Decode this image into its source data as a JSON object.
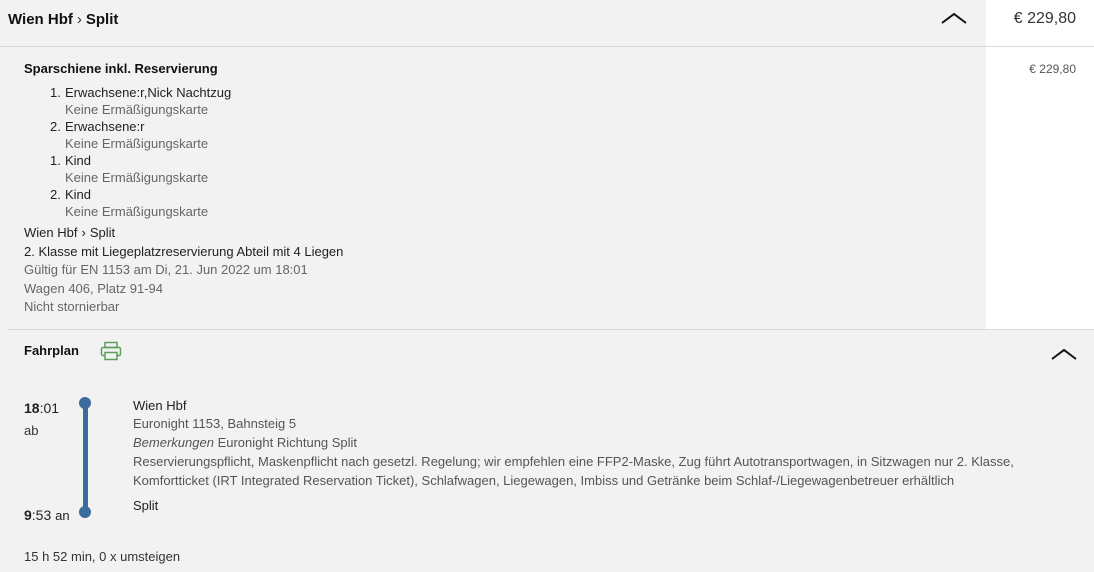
{
  "header": {
    "from": "Wien Hbf",
    "to": "Split",
    "total_price": "€ 229,80"
  },
  "ticket": {
    "title": "Sparschiene inkl. Reservierung",
    "price": "€ 229,80",
    "passengers": [
      {
        "num": "1.",
        "name": "Erwachsene:r,Nick Nachtzug",
        "card": "Keine Ermäßigungskarte"
      },
      {
        "num": "2.",
        "name": "Erwachsene:r",
        "card": "Keine Ermäßigungskarte"
      },
      {
        "num": "1.",
        "name": "Kind",
        "card": "Keine Ermäßigungskarte"
      },
      {
        "num": "2.",
        "name": "Kind",
        "card": "Keine Ermäßigungskarte"
      }
    ],
    "route_from": "Wien Hbf",
    "route_to": "Split",
    "class_info": "2. Klasse mit Liegeplatzreservierung Abteil mit 4 Liegen",
    "validity": "Gültig für EN 1153 am Di, 21. Jun 2022 um 18:01",
    "seat": "Wagen 406, Platz 91-94",
    "cancellation": "Nicht stornierbar"
  },
  "timetable": {
    "label": "Fahrplan",
    "departure": {
      "hour": "18",
      "minute": ":01",
      "suffix": "ab",
      "station": "Wien Hbf",
      "train": "Euronight 1153, Bahnsteig 5",
      "remark_label": "Bemerkungen",
      "remark_text": "Euronight Richtung Split",
      "notes": "Reservierungspflicht, Maskenpflicht nach gesetzl. Regelung; wir empfehlen eine FFP2-Maske, Zug führt Autotransportwagen, in Sitzwagen nur 2. Klasse, Komfortticket (IRT Integrated Reservation Ticket), Schlafwagen, Liegewagen, Imbiss und Getränke beim Schlaf-/Liegewagenbetreuer erhältlich"
    },
    "arrival": {
      "hour": "9",
      "minute": ":53",
      "suffix": "an",
      "station": "Split"
    },
    "duration": "15 h 52 min, 0 x umsteigen"
  },
  "colors": {
    "timeline": "#3c6b9e",
    "printer_icon": "#5aa05a"
  },
  "icons": {
    "route_separator": "chevron-right-icon",
    "collapse": "chevron-up-icon",
    "print": "printer-icon"
  }
}
